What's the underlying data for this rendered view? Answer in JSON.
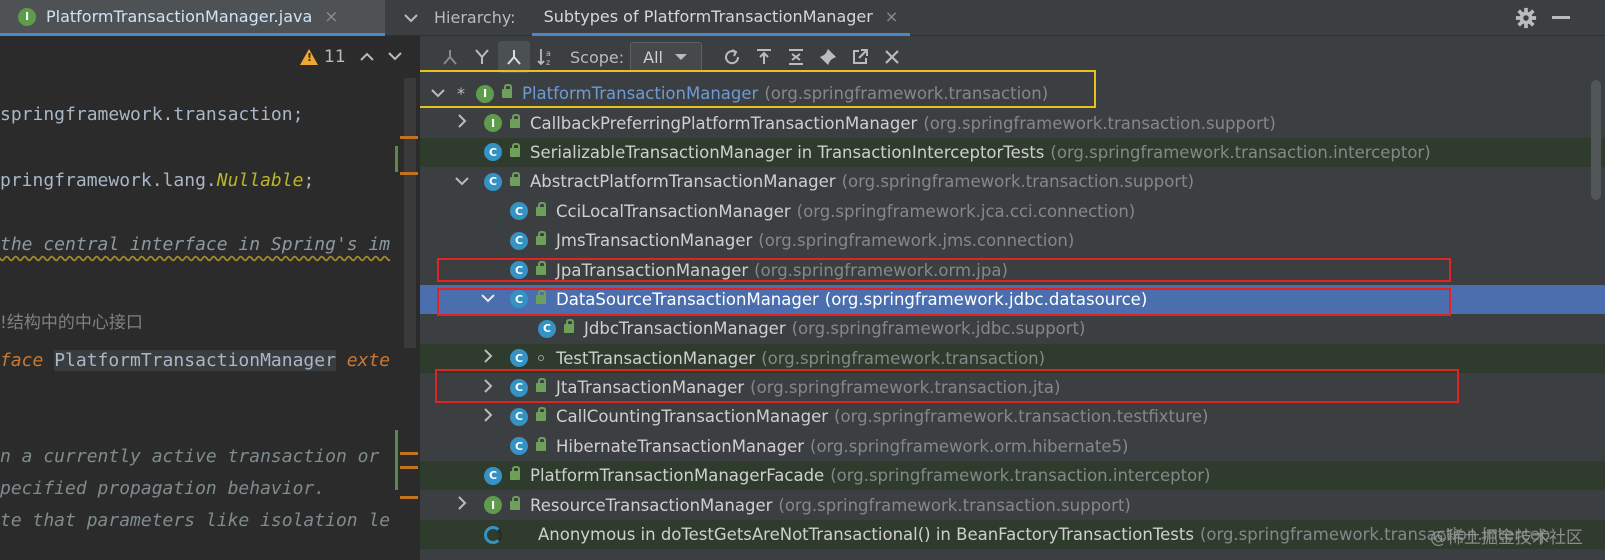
{
  "editor": {
    "file_tab": {
      "name": "PlatformTransactionManager.java",
      "icon": "interface-icon",
      "close": "×"
    },
    "tab_more": "⌄",
    "inspection": {
      "warnings": "11"
    },
    "lines": {
      "l1": "springframework.transaction;",
      "l2_pre": "pringframework.lang.",
      "l2_ann": "Nullable",
      "l2_post": ";",
      "l3": "the central interface in Spring's im",
      "l4": "!结构中的中心接口",
      "l5_kw": "face ",
      "l5_name": "PlatformTransactionManager",
      "l5_post": " exte",
      "l6": "n a currently active transaction or",
      "l7": "pecified propagation behavior.",
      "l8": "te that parameters like isolation le"
    }
  },
  "hierarchy": {
    "label": "Hierarchy:",
    "tab": {
      "label": "Subtypes of PlatformTransactionManager",
      "close": "×"
    },
    "scope_label": "Scope:",
    "scope_value": "All",
    "rows": [
      {
        "name": "PlatformTransactionManager",
        "pkg": "(org.springframework.transaction)"
      },
      {
        "name": "CallbackPreferringPlatformTransactionManager",
        "pkg": "(org.springframework.transaction.support)"
      },
      {
        "name": "SerializableTransactionManager in TransactionInterceptorTests",
        "pkg": "(org.springframework.transaction.interceptor)"
      },
      {
        "name": "AbstractPlatformTransactionManager",
        "pkg": "(org.springframework.transaction.support)"
      },
      {
        "name": "CciLocalTransactionManager",
        "pkg": "(org.springframework.jca.cci.connection)"
      },
      {
        "name": "JmsTransactionManager",
        "pkg": "(org.springframework.jms.connection)"
      },
      {
        "name": "JpaTransactionManager",
        "pkg": "(org.springframework.orm.jpa)"
      },
      {
        "name": "DataSourceTransactionManager",
        "pkg": "(org.springframework.jdbc.datasource)"
      },
      {
        "name": "JdbcTransactionManager",
        "pkg": "(org.springframework.jdbc.support)"
      },
      {
        "name": "TestTransactionManager",
        "pkg": "(org.springframework.transaction)"
      },
      {
        "name": "JtaTransactionManager",
        "pkg": "(org.springframework.transaction.jta)"
      },
      {
        "name": "CallCountingTransactionManager",
        "pkg": "(org.springframework.transaction.testfixture)"
      },
      {
        "name": "HibernateTransactionManager",
        "pkg": "(org.springframework.orm.hibernate5)"
      },
      {
        "name": "PlatformTransactionManagerFacade",
        "pkg": "(org.springframework.transaction.interceptor)"
      },
      {
        "name": "ResourceTransactionManager",
        "pkg": "(org.springframework.transaction.support)"
      },
      {
        "name": "Anonymous in doTestGetsAreNotTransactional() in BeanFactoryTransactionTests",
        "pkg": "(org.springframework.transaction.intercep"
      }
    ]
  },
  "colors": {
    "accent": "#4a88c7",
    "selected_row": "#4b6eaf",
    "highlight_yellow": "#e8c21c",
    "highlight_red": "#e02424",
    "interface_icon": "#5e9b4b",
    "class_icon": "#3592c4"
  },
  "watermark": "@稀土掘金技术社区"
}
